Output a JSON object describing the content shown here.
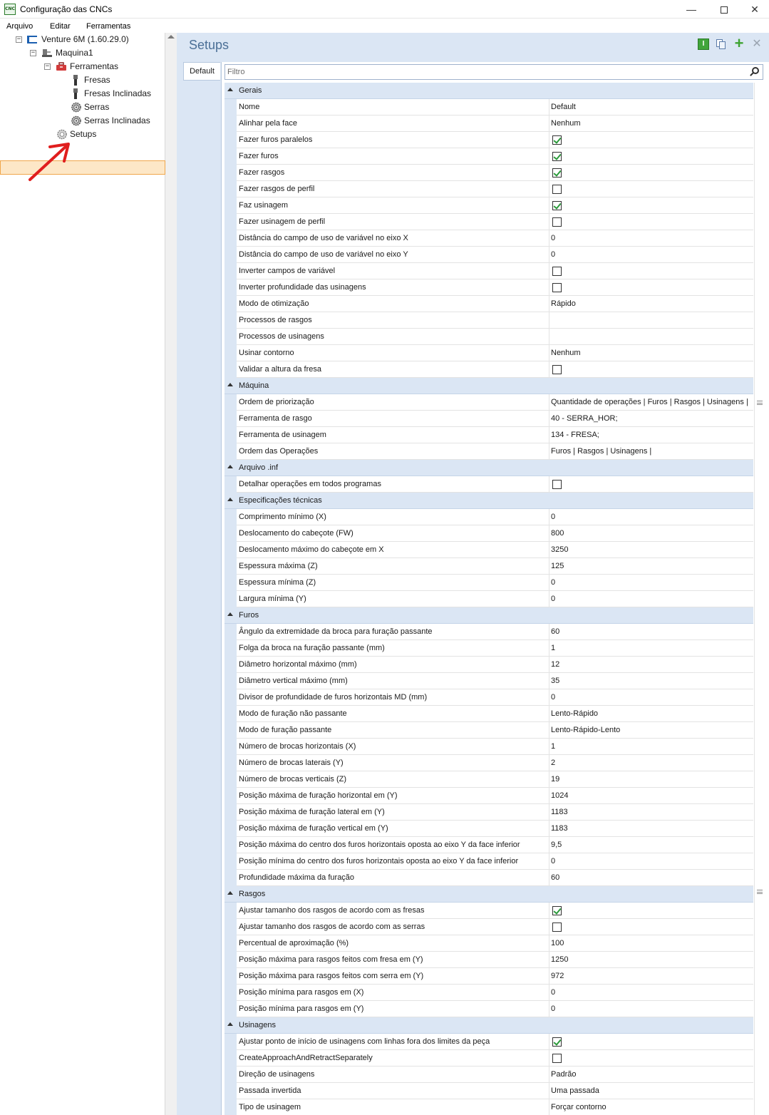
{
  "window": {
    "title": "Configuração das CNCs",
    "app_icon_text": "CNC",
    "controls": [
      "minimize-icon",
      "maximize-icon",
      "close-icon"
    ]
  },
  "menu": [
    "Arquivo",
    "Editar",
    "Ferramentas"
  ],
  "tree": {
    "nodes": [
      {
        "label": "Venture 6M (1.60.29.0)",
        "icon": "machine-series-icon",
        "expanded": true
      },
      {
        "label": "Maquina1",
        "icon": "machine-icon",
        "expanded": true
      },
      {
        "label": "Ferramentas",
        "icon": "toolbox-icon",
        "expanded": true
      },
      {
        "label": "Fresas",
        "icon": "drill-bit-icon"
      },
      {
        "label": "Fresas Inclinadas",
        "icon": "drill-bit-icon"
      },
      {
        "label": "Serras",
        "icon": "saw-gear-icon"
      },
      {
        "label": "Serras Inclinadas",
        "icon": "saw-gear-icon"
      },
      {
        "label": "Setups",
        "icon": "gear-icon",
        "selected": true
      }
    ],
    "annotation": "red-arrow-icon"
  },
  "main": {
    "title": "Setups",
    "toolbar": [
      "info-icon",
      "copy-icon",
      "add-icon",
      "delete-icon"
    ],
    "tab": "Default",
    "filter_placeholder": "Filtro"
  },
  "sections": [
    {
      "title": "Gerais",
      "rows": [
        {
          "name": "Nome",
          "value": "Default"
        },
        {
          "name": "Alinhar pela face",
          "value": "Nenhum"
        },
        {
          "name": "Fazer furos paralelos",
          "check": true
        },
        {
          "name": "Fazer furos",
          "check": true
        },
        {
          "name": "Fazer rasgos",
          "check": true
        },
        {
          "name": "Fazer rasgos de perfil",
          "check": false
        },
        {
          "name": "Faz usinagem",
          "check": true
        },
        {
          "name": "Fazer usinagem de perfil",
          "check": false
        },
        {
          "name": "Distância do campo de uso de variável no eixo X",
          "value": "0"
        },
        {
          "name": "Distância do campo de uso de variável no eixo Y",
          "value": "0"
        },
        {
          "name": "Inverter campos de variável",
          "check": false
        },
        {
          "name": "Inverter profundidade das usinagens",
          "check": false
        },
        {
          "name": "Modo de otimização",
          "value": "Rápido"
        },
        {
          "name": "Processos de rasgos",
          "value": ""
        },
        {
          "name": "Processos de usinagens",
          "value": ""
        },
        {
          "name": "Usinar contorno",
          "value": "Nenhum"
        },
        {
          "name": "Validar a altura da fresa",
          "check": false
        }
      ]
    },
    {
      "title": "Máquina",
      "rows": [
        {
          "name": "Ordem de priorização",
          "value": "Quantidade de operações | Furos | Rasgos | Usinagens |"
        },
        {
          "name": "Ferramenta de rasgo",
          "value": "40 - SERRA_HOR;"
        },
        {
          "name": "Ferramenta de usinagem",
          "value": "134 - FRESA;"
        },
        {
          "name": "Ordem das Operações",
          "value": "Furos | Rasgos | Usinagens |"
        }
      ]
    },
    {
      "title": "Arquivo .inf",
      "rows": [
        {
          "name": "Detalhar operações em todos programas",
          "check": false
        }
      ]
    },
    {
      "title": "Especificações técnicas",
      "rows": [
        {
          "name": "Comprimento mínimo (X)",
          "value": "0"
        },
        {
          "name": "Deslocamento do cabeçote (FW)",
          "value": "800"
        },
        {
          "name": "Deslocamento máximo do cabeçote em X",
          "value": "3250"
        },
        {
          "name": "Espessura máxima (Z)",
          "value": "125"
        },
        {
          "name": "Espessura mínima (Z)",
          "value": "0"
        },
        {
          "name": "Largura mínima (Y)",
          "value": "0"
        }
      ]
    },
    {
      "title": "Furos",
      "rows": [
        {
          "name": "Ângulo da extremidade da broca para furação passante",
          "value": "60"
        },
        {
          "name": "Folga da broca na furação passante (mm)",
          "value": "1"
        },
        {
          "name": "Diâmetro horizontal máximo (mm)",
          "value": "12"
        },
        {
          "name": "Diâmetro vertical máximo (mm)",
          "value": "35"
        },
        {
          "name": "Divisor de profundidade de furos horizontais MD (mm)",
          "value": "0"
        },
        {
          "name": "Modo de furação não passante",
          "value": "Lento-Rápido"
        },
        {
          "name": "Modo de furação passante",
          "value": "Lento-Rápido-Lento"
        },
        {
          "name": "Número de brocas horizontais (X)",
          "value": "1"
        },
        {
          "name": "Número de brocas laterais (Y)",
          "value": "2"
        },
        {
          "name": "Número de brocas verticais (Z)",
          "value": "19"
        },
        {
          "name": "Posição máxima de furação horizontal em (Y)",
          "value": "1024"
        },
        {
          "name": "Posição máxima de furação lateral em (Y)",
          "value": "1183"
        },
        {
          "name": "Posição máxima de furação vertical em (Y)",
          "value": "1183"
        },
        {
          "name": "Posição máxima do centro dos furos horizontais oposta ao eixo Y da face inferior",
          "value": "9,5"
        },
        {
          "name": "Posição mínima do centro dos furos horizontais oposta ao eixo Y da face inferior",
          "value": "0"
        },
        {
          "name": "Profundidade máxima da furação",
          "value": "60"
        }
      ]
    },
    {
      "title": "Rasgos",
      "rows": [
        {
          "name": "Ajustar tamanho dos rasgos de acordo com as fresas",
          "check": true
        },
        {
          "name": "Ajustar tamanho dos rasgos de acordo com as serras",
          "check": false
        },
        {
          "name": "Percentual de aproximação (%)",
          "value": "100"
        },
        {
          "name": "Posição máxima para rasgos feitos com fresa em (Y)",
          "value": "1250"
        },
        {
          "name": "Posição máxima para rasgos feitos com serra em (Y)",
          "value": "972"
        },
        {
          "name": "Posição mínima para rasgos em (X)",
          "value": "0"
        },
        {
          "name": "Posição mínima para rasgos em (Y)",
          "value": "0"
        }
      ]
    },
    {
      "title": "Usinagens",
      "rows": [
        {
          "name": "Ajustar ponto de início de usinagens com linhas fora dos limites da peça",
          "check": true
        },
        {
          "name": "CreateApproachAndRetractSeparately",
          "check": false
        },
        {
          "name": "Direção de usinagens",
          "value": "Padrão"
        },
        {
          "name": "Passada invertida",
          "value": "Uma passada"
        },
        {
          "name": "Tipo de usinagem",
          "value": "Forçar contorno"
        }
      ]
    }
  ]
}
